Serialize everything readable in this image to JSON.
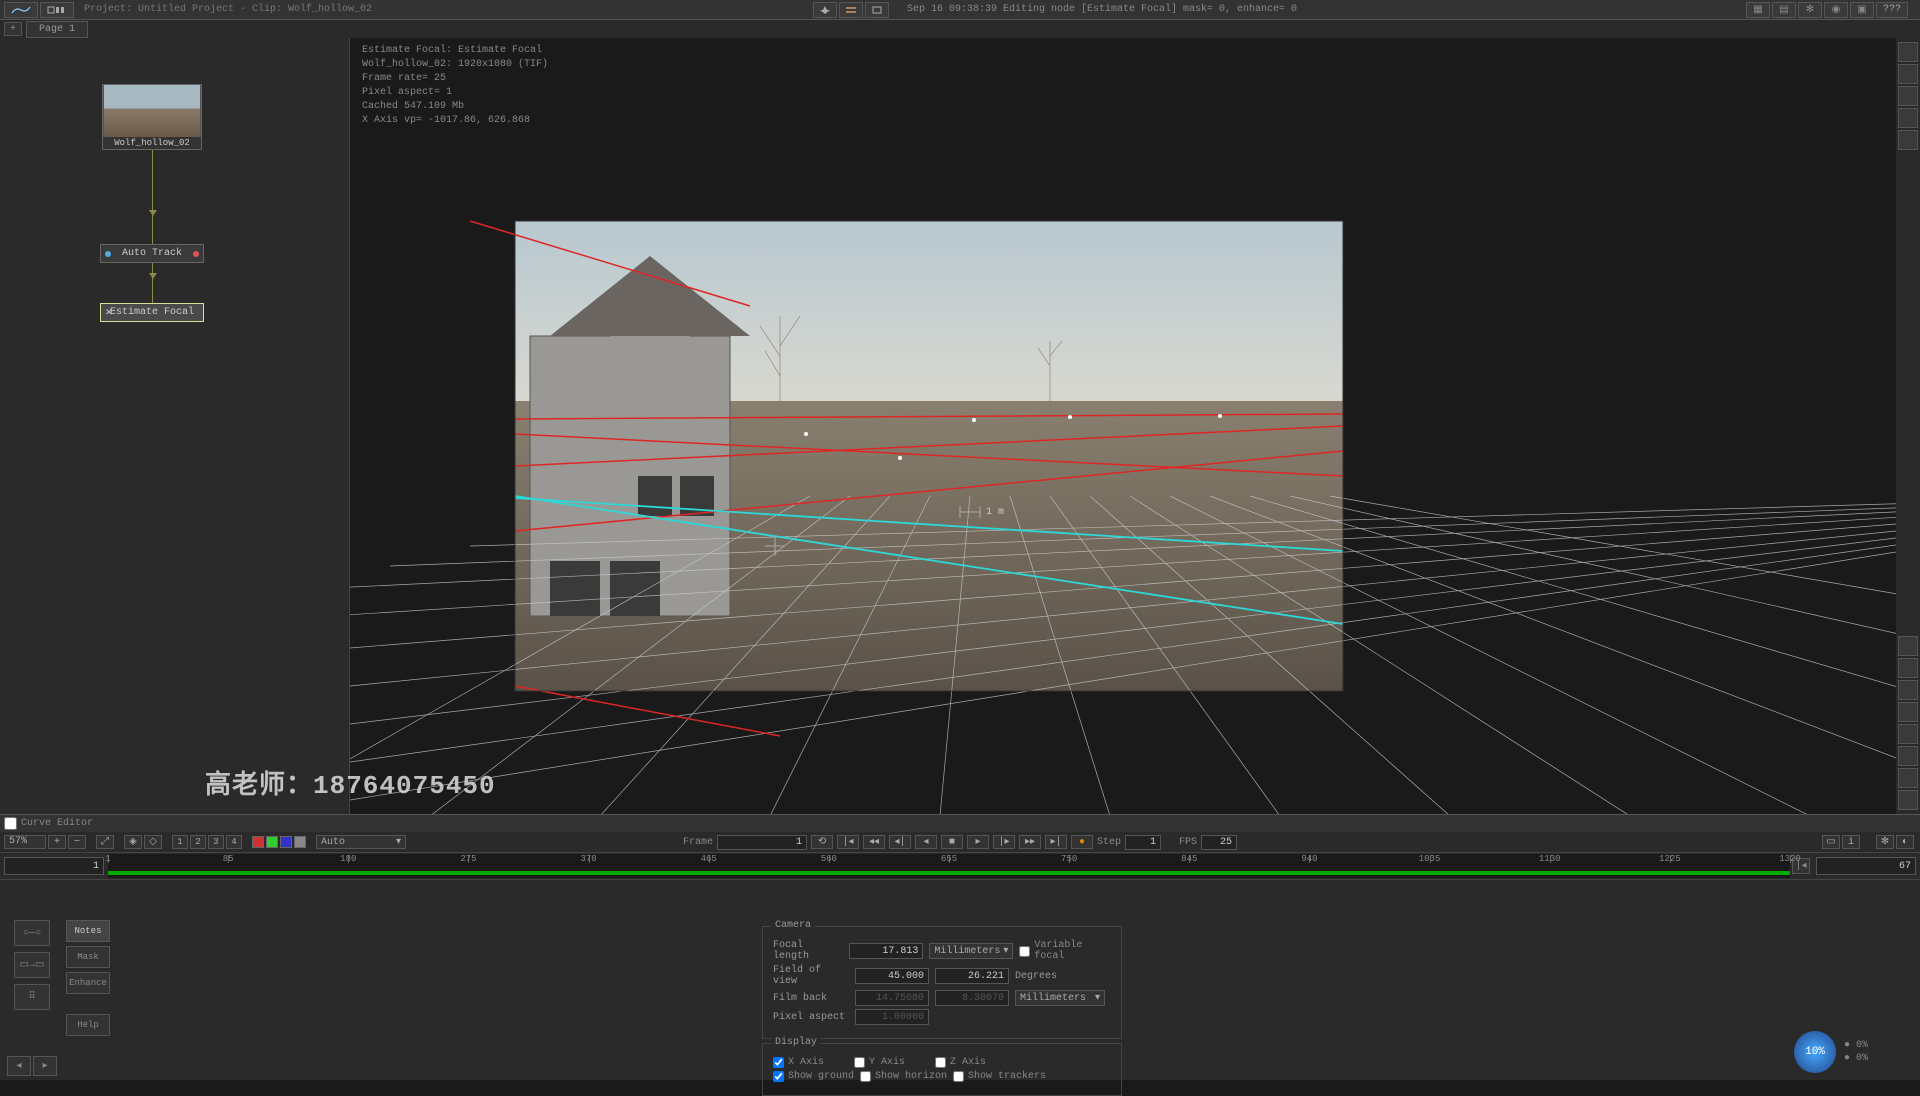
{
  "topbar": {
    "project_label": "Project: Untitled Project - Clip: Wolf_hollow_02",
    "status": "Sep 16 09:38:39 Editing node [Estimate Focal] mask= 0, enhance= 0",
    "help_label": "???"
  },
  "pagetab": {
    "page1": "Page 1",
    "plus": "+"
  },
  "nodes": {
    "clip_name": "Wolf_hollow_02",
    "auto_track": "Auto Track",
    "estimate_focal": "Estimate Focal"
  },
  "viewport_info": {
    "line1": "Estimate Focal: Estimate Focal",
    "line2": "Wolf_hollow_02: 1920x1080 (TIF)",
    "line3": "Frame rate= 25",
    "line4": "Pixel aspect= 1",
    "line5": "Cached 547.109 Mb",
    "line6": "X Axis vp= -1017.86, 626.868",
    "scale_label": "1 m"
  },
  "curve_editor": {
    "label": "Curve Editor"
  },
  "timeline_ctrl": {
    "zoom": "57%",
    "auto": "Auto",
    "btns": {
      "n1": "1",
      "n2": "2",
      "n3": "3",
      "n4": "4"
    },
    "frame_label": "Frame",
    "frame_value": "1",
    "step_label": "Step",
    "step_value": "1",
    "fps_label": "FPS",
    "fps_value": "25"
  },
  "timeline": {
    "current_frame": "1",
    "end_frame": "67",
    "ticks": [
      "1",
      "85",
      "180",
      "275",
      "370",
      "465",
      "560",
      "655",
      "750",
      "845",
      "940",
      "1035",
      "1130",
      "1225",
      "1320"
    ]
  },
  "bp_tabs": {
    "notes": "Notes",
    "mask": "Mask",
    "enhance": "Enhance",
    "help": "Help"
  },
  "props": {
    "camera_title": "Camera",
    "display_title": "Display",
    "focal_length": {
      "label": "Focal length",
      "value": "17.813",
      "unit": "Millimeters"
    },
    "variable_focal": "Variable focal",
    "fov": {
      "label": "Field of view",
      "h": "45.000",
      "v": "26.221",
      "unit": "Degrees"
    },
    "film_back": {
      "label": "Film back",
      "w": "14.75680",
      "h": "8.30070",
      "unit": "Millimeters"
    },
    "pixel_aspect": {
      "label": "Pixel aspect",
      "value": "1.00000"
    },
    "xaxis": "X Axis",
    "yaxis": "Y Axis",
    "zaxis": "Z Axis",
    "show_ground": "Show ground",
    "show_horizon": "Show horizon",
    "show_trackers": "Show trackers"
  },
  "perf": {
    "pct": "10%",
    "a": "0%",
    "b": "0%"
  },
  "watermark": "高老师：18764075450"
}
